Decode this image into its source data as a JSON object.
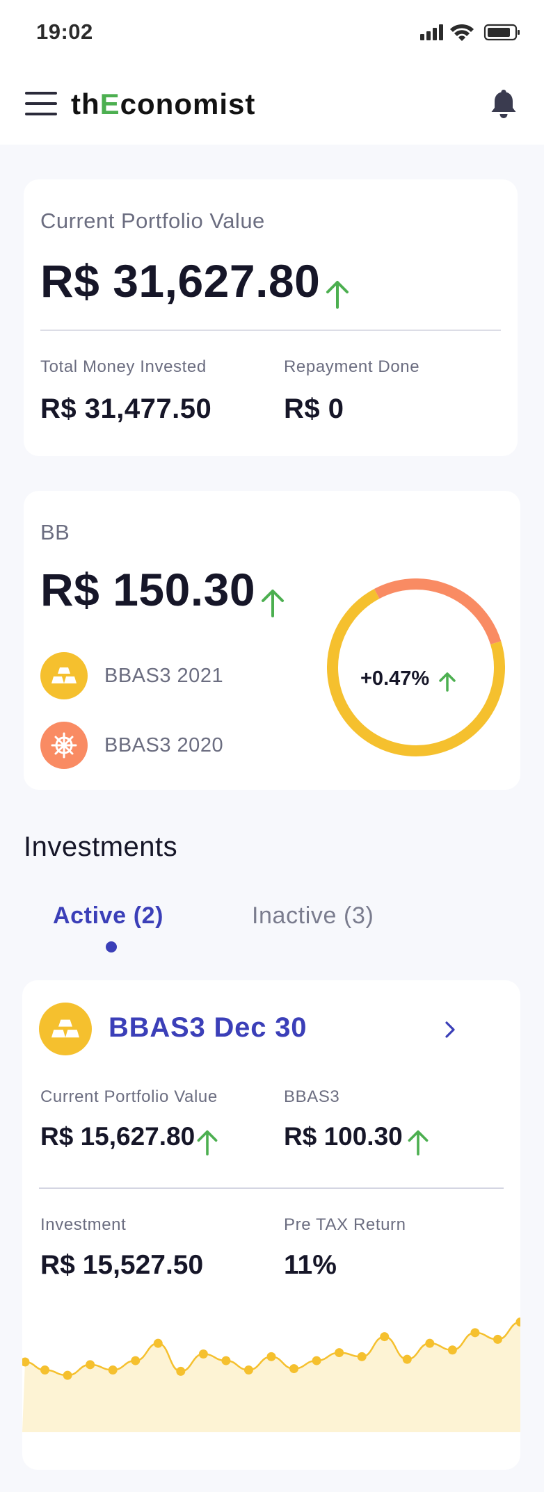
{
  "status_bar": {
    "time": "19:02"
  },
  "header": {
    "brand_prefix": "th",
    "brand_highlight": "E",
    "brand_suffix": "conomist"
  },
  "portfolio": {
    "title": "Current Portfolio Value",
    "value": "R$ 31,627.80",
    "total_invested_label": "Total Money Invested",
    "total_invested_value": "R$ 31,477.50",
    "repayment_label": "Repayment Done",
    "repayment_value": "R$ 0"
  },
  "bb_card": {
    "title": "BB",
    "value": "R$ 150.30",
    "items": [
      {
        "label": "BBAS3 2021",
        "icon": "gold-bars-icon",
        "color": "#f5c02e"
      },
      {
        "label": "BBAS3 2020",
        "icon": "ship-wheel-icon",
        "color": "#f98b63"
      }
    ],
    "donut": {
      "center_text": "+0.47%",
      "segments": [
        {
          "label": "BBAS3 2021",
          "fraction": 0.72,
          "color": "#f5c02e"
        },
        {
          "label": "BBAS3 2020",
          "fraction": 0.28,
          "color": "#f98b63"
        }
      ]
    }
  },
  "investments": {
    "section_title": "Investments",
    "tabs": [
      {
        "label": "Active (2)",
        "active": true
      },
      {
        "label": "Inactive (3)",
        "active": false
      }
    ],
    "card": {
      "name": "BBAS3 Dec 30",
      "current_value_label": "Current Portfolio Value",
      "current_value": "R$ 15,627.80",
      "ticker_label": "BBAS3",
      "ticker_value": "R$ 100.30",
      "investment_label": "Investment",
      "investment_value": "R$ 15,527.50",
      "pretax_label": "Pre TAX Return",
      "pretax_value": "11%"
    }
  },
  "colors": {
    "accent": "#3b3fb8",
    "up_green": "#4caf50",
    "gold": "#f5c02e",
    "coral": "#f98b63",
    "sparkline_fill": "#fdf3d4"
  },
  "chart_data": {
    "type": "area",
    "series": [
      {
        "values": [
          44,
          38,
          34,
          42,
          38,
          45,
          58,
          37,
          50,
          45,
          38,
          48,
          39,
          45,
          51,
          48,
          63,
          46,
          58,
          53,
          66,
          61,
          74
        ]
      }
    ]
  }
}
